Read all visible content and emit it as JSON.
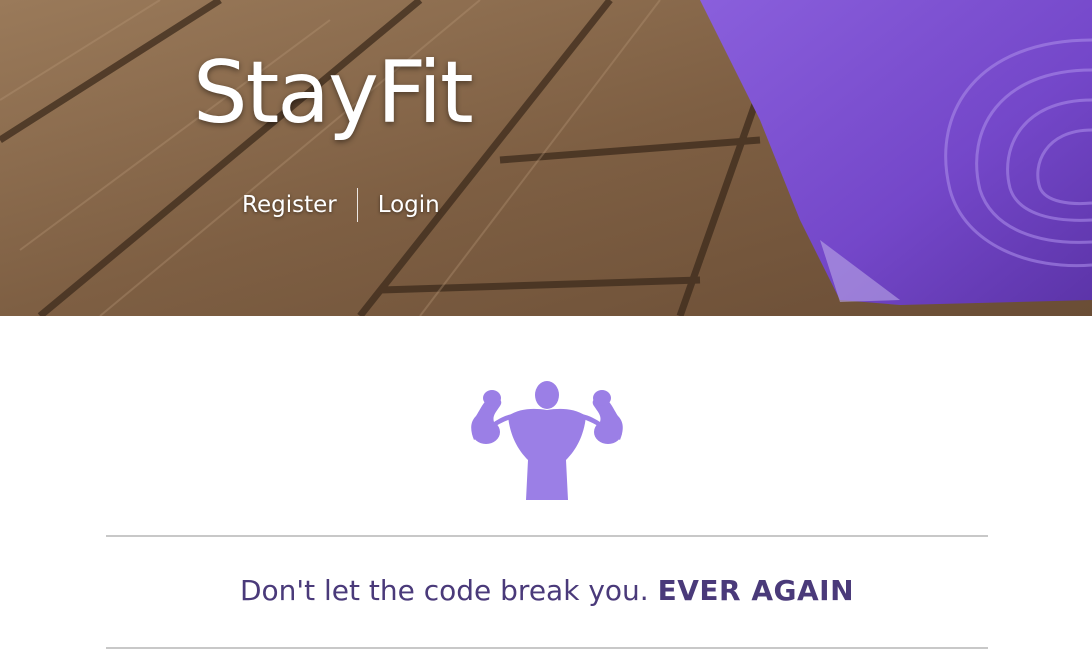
{
  "brand": {
    "title": "StayFit"
  },
  "hero_nav": {
    "register_label": "Register",
    "login_label": "Login"
  },
  "logo": {
    "icon": "bodybuilder-flexing-icon",
    "color": "#9b7fe6"
  },
  "tagline": {
    "text": "Don't let the code break you.",
    "emphasis": "EVER AGAIN",
    "color": "#4a3a7a"
  },
  "colors": {
    "accent": "#9b7fe6",
    "mat": "#7d4fd1",
    "divider": "#c8c8c8"
  }
}
